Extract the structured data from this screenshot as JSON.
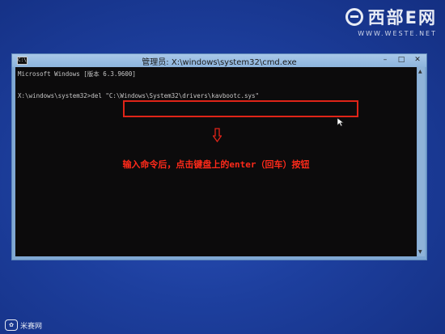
{
  "brand": {
    "name": "西部E网",
    "url": "WWW.WESTE.NET"
  },
  "window": {
    "title": "管理员: X:\\windows\\system32\\cmd.exe",
    "icon_label": "C:\\",
    "btn_minimize": "–",
    "btn_maximize": "□",
    "btn_close": "✕"
  },
  "console": {
    "line1": "Microsoft Windows [版本 6.3.9600]",
    "prompt": "X:\\windows\\system32>",
    "command": "del \"C:\\Windows\\System32\\drivers\\kavbootc.sys\""
  },
  "annotation": "输入命令后，点击键盘上的enter（回车）按钮",
  "watermark": {
    "logo": "✿",
    "text": "米赛网"
  },
  "colors": {
    "highlight": "#e02418",
    "annotation": "#ff2a1a",
    "console_bg": "#0c0b0c"
  }
}
